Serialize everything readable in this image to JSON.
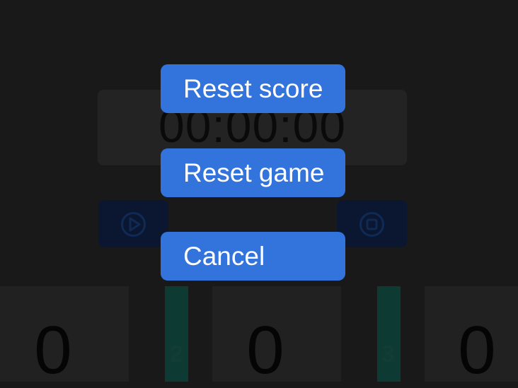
{
  "timer": {
    "value": "00:00:00"
  },
  "controls": {
    "play_icon": "play-circle-icon",
    "stop_icon": "stop-circle-icon"
  },
  "scores": [
    {
      "value": "0"
    },
    {
      "value": "0"
    },
    {
      "value": "0"
    }
  ],
  "bars": [
    {
      "label": "2"
    },
    {
      "label": "3"
    }
  ],
  "dialog": {
    "reset_score_label": "Reset score",
    "reset_game_label": "Reset game",
    "cancel_label": "Cancel"
  },
  "colors": {
    "accent": "#3273dc",
    "background": "#191919"
  }
}
